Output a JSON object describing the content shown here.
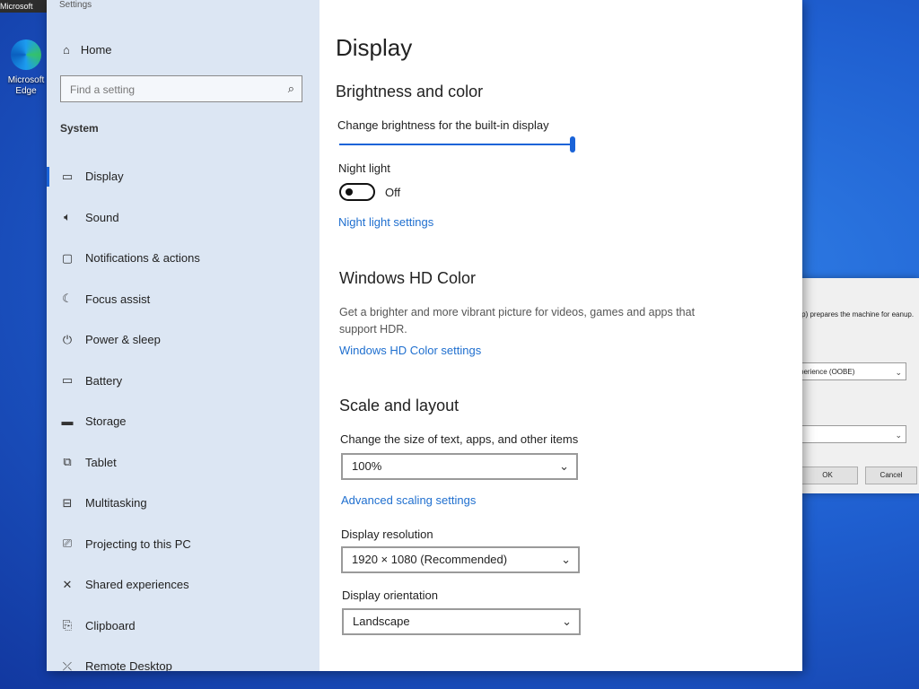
{
  "desktop": {
    "tab_label": "Microsoft Edge",
    "icon_label": "Microsoft Edge"
  },
  "window": {
    "title": "Settings"
  },
  "sidebar": {
    "home_label": "Home",
    "search_placeholder": "Find a setting",
    "section_title": "System",
    "items": [
      {
        "label": "Display",
        "icon": "display-icon"
      },
      {
        "label": "Sound",
        "icon": "speaker-icon"
      },
      {
        "label": "Notifications & actions",
        "icon": "notification-icon"
      },
      {
        "label": "Focus assist",
        "icon": "moon-icon"
      },
      {
        "label": "Power & sleep",
        "icon": "power-icon"
      },
      {
        "label": "Battery",
        "icon": "battery-icon"
      },
      {
        "label": "Storage",
        "icon": "storage-icon"
      },
      {
        "label": "Tablet",
        "icon": "tablet-icon"
      },
      {
        "label": "Multitasking",
        "icon": "multitasking-icon"
      },
      {
        "label": "Projecting to this PC",
        "icon": "projecting-icon"
      },
      {
        "label": "Shared experiences",
        "icon": "shared-icon"
      },
      {
        "label": "Clipboard",
        "icon": "clipboard-icon"
      },
      {
        "label": "Remote Desktop",
        "icon": "remote-desktop-icon"
      }
    ]
  },
  "main": {
    "title": "Display",
    "brightness": {
      "heading": "Brightness and color",
      "slider_label": "Change brightness for the built-in display",
      "slider_level": 100,
      "night_light_label": "Night light",
      "night_light_state": "Off",
      "night_light_link": "Night light settings"
    },
    "hd_color": {
      "heading": "Windows HD Color",
      "description": "Get a brighter and more vibrant picture for videos, games and apps that support HDR.",
      "link": "Windows HD Color settings"
    },
    "scale": {
      "heading": "Scale and layout",
      "size_label": "Change the size of text, apps, and other items",
      "size_value": "100%",
      "advanced_link": "Advanced scaling settings",
      "resolution_label": "Display resolution",
      "resolution_value": "1920 × 1080 (Recommended)",
      "orientation_label": "Display orientation",
      "orientation_value": "Landscape"
    }
  },
  "background_dialog": {
    "text": "rep) prepares the machine for eanup.",
    "combo1": "perience (OOBE)",
    "combo2": "",
    "ok_label": "OK",
    "cancel_label": "Cancel"
  },
  "colors": {
    "accent": "#1a63d8",
    "link": "#1f6fcf",
    "sidebar_bg": "#dce6f3",
    "desktop": "#1f5fd0"
  }
}
